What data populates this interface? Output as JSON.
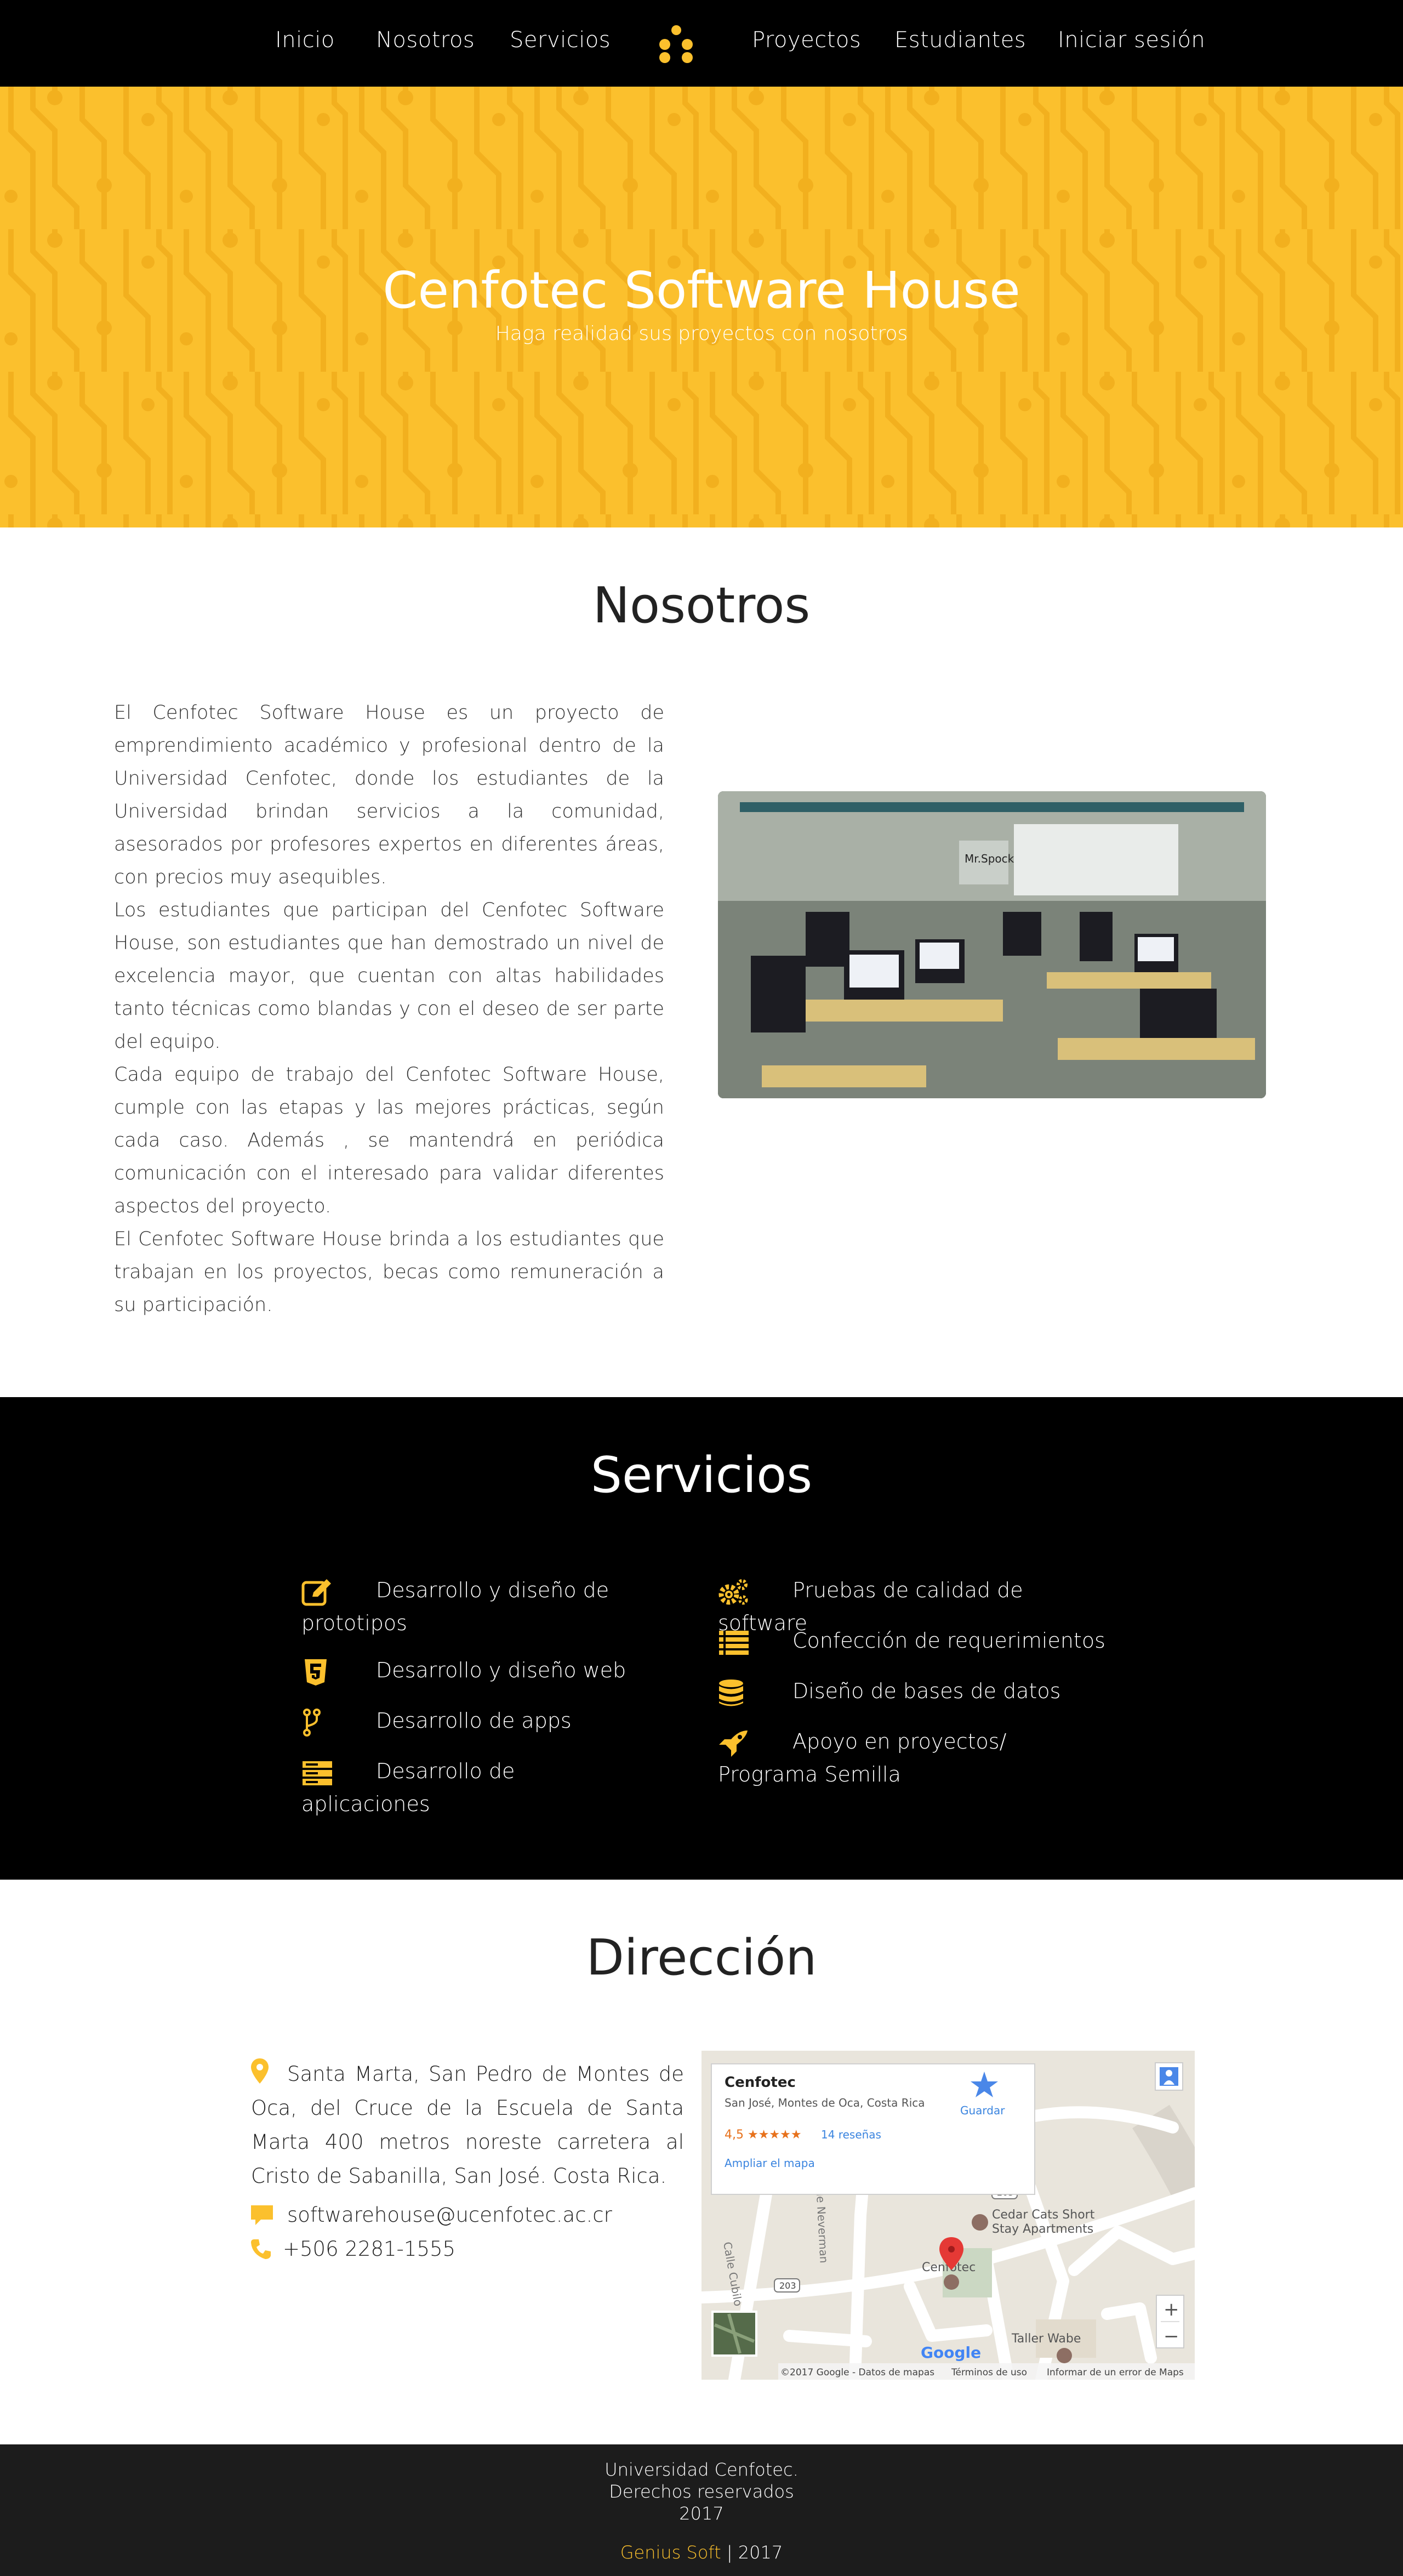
{
  "colors": {
    "accent": "#fbc02d",
    "nav_bg": "#000000",
    "footer_bg": "#1c1c1c"
  },
  "nav": {
    "items": [
      "Inicio",
      "Nosotros",
      "Servicios",
      "Proyectos",
      "Estudiantes",
      "Iniciar sesión"
    ],
    "logo_icon": "dots-logo-icon"
  },
  "hero": {
    "title": "Cenfotec Software House",
    "subtitle": "Haga realidad sus proyectos con nosotros"
  },
  "nosotros": {
    "title": "Nosotros",
    "paragraphs": [
      "El Cenfotec Software House es un proyecto de emprendimiento académico y profesional dentro de la Universidad Cenfotec, donde los estudiantes de la Universidad brindan servicios a la comunidad, asesorados por profesores expertos en diferentes áreas, con precios muy asequibles.",
      "Los estudiantes que participan del Cenfotec Software House, son estudiantes que han demostrado un nivel de excelencia mayor, que cuentan con altas habilidades tanto técnicas como blandas y con el deseo de ser parte del equipo.",
      "Cada equipo de trabajo del Cenfotec Software House, cumple con las etapas y las mejores prácticas, según cada caso. Además , se mantendrá en periódica comunicación con el interesado para validar diferentes aspectos del proyecto.",
      "El Cenfotec Software House brinda a los estudiantes que trabajan en los proyectos, becas como remuneración a su participación."
    ],
    "photo_sign": "Mr.Spock"
  },
  "servicios": {
    "title": "Servicios",
    "left": [
      {
        "label": "Desarrollo y diseño de prototipos",
        "icon": "edit-icon"
      },
      {
        "label": "Desarrollo y diseño web",
        "icon": "html5-icon"
      },
      {
        "label": "Desarrollo de apps",
        "icon": "code-fork-icon"
      },
      {
        "label": "Desarrollo de aplicaciones",
        "icon": "server-icon"
      }
    ],
    "right": [
      {
        "label": "Pruebas de calidad de software",
        "icon": "gears-icon"
      },
      {
        "label": "Confección de requerimientos",
        "icon": "list-icon"
      },
      {
        "label": "Diseño de bases de datos",
        "icon": "database-icon"
      },
      {
        "label": "Apoyo en proyectos/ Programa Semilla",
        "icon": "rocket-icon"
      }
    ]
  },
  "direccion": {
    "title": "Dirección",
    "address": "Santa Marta, San Pedro de Montes de Oca, del Cruce de la Escuela de Santa Marta 400 metros noreste carretera al Cristo de Sabanilla, San José. Costa Rica.",
    "email": "softwarehouse@ucenfotec.ac.cr",
    "phone": "+506 2281-1555"
  },
  "map": {
    "place_name": "Cenfotec",
    "place_address": "San José, Montes de Oca, Costa Rica",
    "rating": "4,5 ★★★★★",
    "reviews": "14 reseñas",
    "save_label": "Guardar",
    "expand_label": "Ampliar el mapa",
    "poi_1": "Cedar Cats Short",
    "poi_1b": "Stay Apartments",
    "poi_2": "Cenfotec",
    "poi_3": "Taller Wabe",
    "street_1": "Calle Cubilo",
    "street_2": "le Neverman",
    "route": "203",
    "zoom_in": "+",
    "zoom_out": "−",
    "google": "Google",
    "copyright": "©2017 Google - Datos de mapas",
    "terms": "Términos de uso",
    "report": "Informar de un error de Maps"
  },
  "footer": {
    "line1": "Universidad Cenfotec.",
    "line2": "Derechos reservados",
    "line3": "2017",
    "brand": "Genius Soft",
    "separator": " | ",
    "year": "2017"
  }
}
